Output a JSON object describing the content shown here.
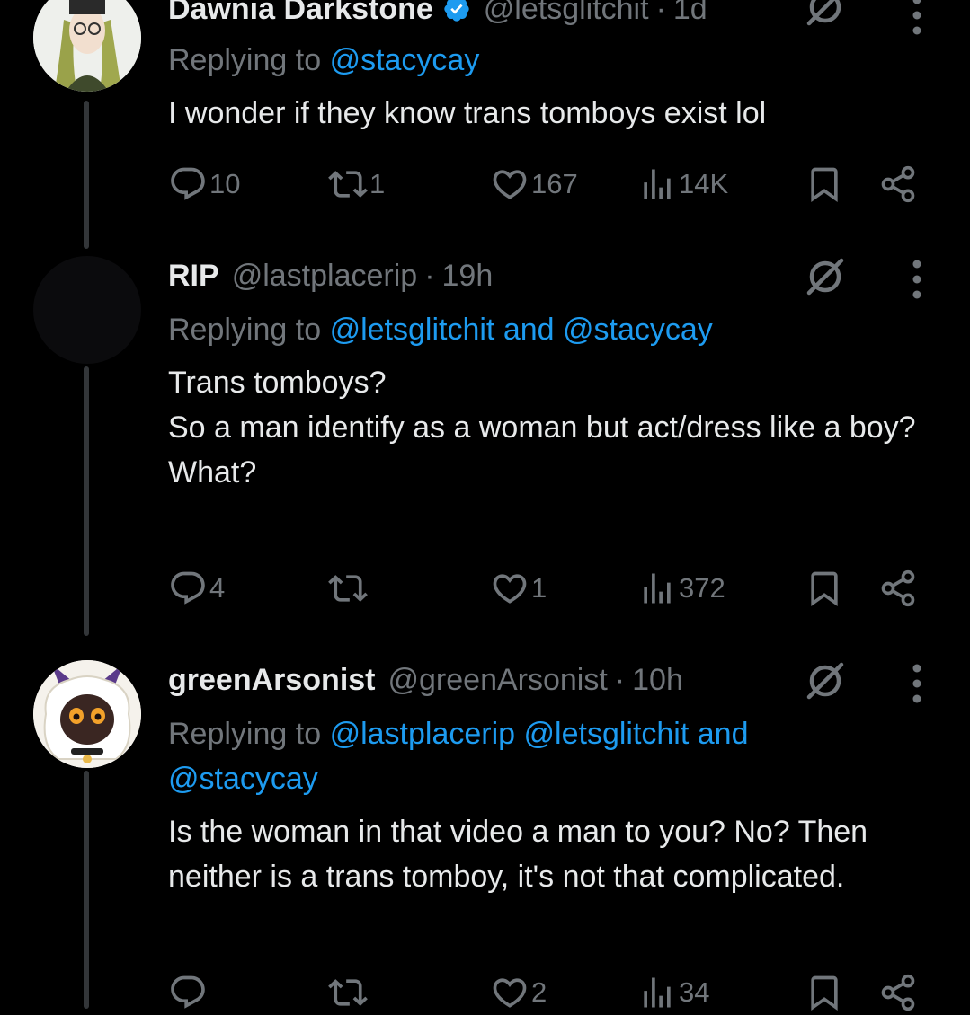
{
  "tweets": [
    {
      "name": "Dawnia Darkstone",
      "verified": true,
      "handle": "@letsglitchit",
      "time": "1d",
      "replying_prefix": "Replying to",
      "replying_to": [
        "@stacycay"
      ],
      "replying_joiner": "",
      "body": [
        "I wonder if they know trans tomboys exist lol"
      ],
      "stats": {
        "replies": "10",
        "reposts": "1",
        "likes": "167",
        "views": "14K"
      }
    },
    {
      "name": "RIP",
      "verified": false,
      "handle": "@lastplacerip",
      "time": "19h",
      "replying_prefix": "Replying to",
      "replying_to": [
        "@letsglitchit",
        "@stacycay"
      ],
      "replying_joiner": "and",
      "body": [
        "Trans tomboys?",
        "So a man identify as a woman but act/dress like a boy?",
        "What?"
      ],
      "stats": {
        "replies": "4",
        "reposts": "",
        "likes": "1",
        "views": "372"
      }
    },
    {
      "name": "greenArsonist",
      "verified": false,
      "handle": "@greenArsonist",
      "time": "10h",
      "replying_prefix": "Replying to",
      "replying_to": [
        "@lastplacerip",
        "@letsglitchit",
        "@stacycay"
      ],
      "replying_joiner": "and",
      "body": [
        "Is the woman in that video a man to you? No? Then neither is a trans tomboy, it's not that complicated."
      ],
      "stats": {
        "replies": "",
        "reposts": "",
        "likes": "2",
        "views": "34"
      }
    }
  ],
  "separator": "·",
  "icons": [
    "verified-icon",
    "grok-icon",
    "more-icon",
    "reply-icon",
    "repost-icon",
    "like-icon",
    "views-icon",
    "bookmark-icon",
    "share-icon"
  ],
  "colors": {
    "background": "#000000",
    "text": "#e7e9ea",
    "muted": "#71767b",
    "link": "#1d9bf0",
    "thread_line": "#333639"
  }
}
